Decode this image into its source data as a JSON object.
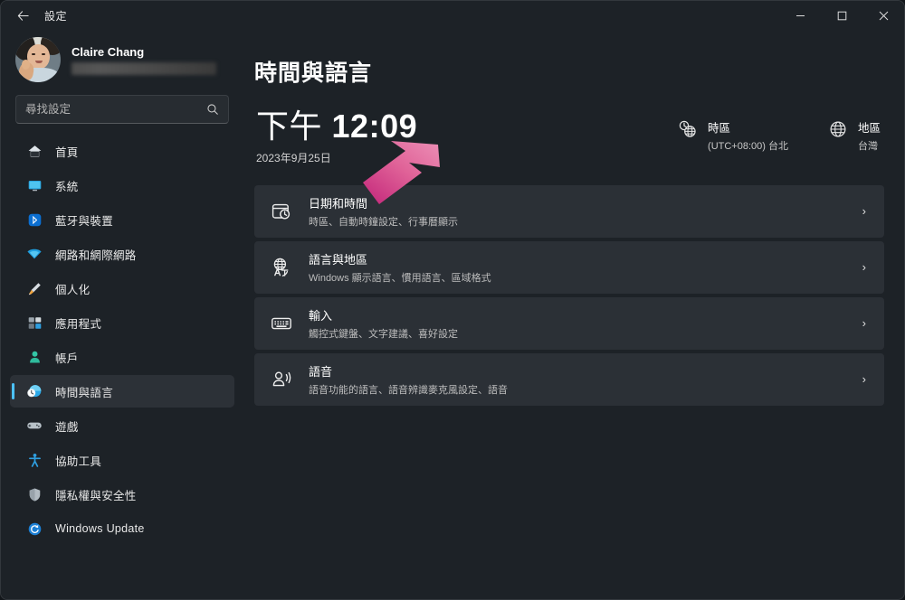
{
  "window": {
    "app_title": "設定",
    "back_icon": "back-arrow-icon",
    "minimize_label": "─",
    "maximize_label": "□",
    "close_label": "✕"
  },
  "sidebar": {
    "profile": {
      "name": "Claire Chang",
      "email_redacted": "",
      "avatar_icon": "user-avatar-photo"
    },
    "search": {
      "placeholder": "尋找設定",
      "value": "",
      "icon": "search-icon"
    },
    "items": [
      {
        "label": "首頁",
        "icon": "home-icon",
        "active": false
      },
      {
        "label": "系統",
        "icon": "system-monitor-icon",
        "active": false
      },
      {
        "label": "藍牙與裝置",
        "icon": "bluetooth-icon",
        "active": false
      },
      {
        "label": "網路和網際網路",
        "icon": "wifi-icon",
        "active": false
      },
      {
        "label": "個人化",
        "icon": "paintbrush-icon",
        "active": false
      },
      {
        "label": "應用程式",
        "icon": "apps-grid-icon",
        "active": false
      },
      {
        "label": "帳戶",
        "icon": "account-person-icon",
        "active": false
      },
      {
        "label": "時間與語言",
        "icon": "clock-globe-icon",
        "active": true
      },
      {
        "label": "遊戲",
        "icon": "gamepad-icon",
        "active": false
      },
      {
        "label": "協助工具",
        "icon": "accessibility-icon",
        "active": false
      },
      {
        "label": "隱私權與安全性",
        "icon": "shield-icon",
        "active": false
      },
      {
        "label": "Windows Update",
        "icon": "update-refresh-icon",
        "active": false
      }
    ]
  },
  "main": {
    "page_title": "時間與語言",
    "clock": {
      "ampm": "下午",
      "time": "12:09",
      "date": "2023年9月25日"
    },
    "info": [
      {
        "label": "時區",
        "value": "(UTC+08:00) 台北",
        "icon": "clock-globe-icon"
      },
      {
        "label": "地區",
        "value": "台灣",
        "icon": "globe-icon"
      }
    ],
    "cards": [
      {
        "title": "日期和時間",
        "subtitle": "時區、自動時鐘設定、行事曆顯示",
        "icon": "calendar-clock-icon",
        "chevron": "›"
      },
      {
        "title": "語言與地區",
        "subtitle": "Windows 顯示語言、慣用語言、區域格式",
        "icon": "language-globe-icon",
        "chevron": "›"
      },
      {
        "title": "輸入",
        "subtitle": "觸控式鍵盤、文字建議、喜好設定",
        "icon": "keyboard-icon",
        "chevron": "›"
      },
      {
        "title": "語音",
        "subtitle": "語音功能的語言、語音辨識麥克風設定、語音",
        "icon": "speech-icon",
        "chevron": "›"
      }
    ]
  },
  "annotation": {
    "arrow_icon": "pink-arrow-pointing-down-left",
    "color_start": "#e87aa8",
    "color_end": "#c9317f"
  },
  "colors": {
    "window_bg": "#1d2227",
    "card_bg": "#2b3036",
    "accent": "#4cc2ff",
    "text_primary": "#ffffff",
    "text_secondary": "#bdbdbd"
  }
}
